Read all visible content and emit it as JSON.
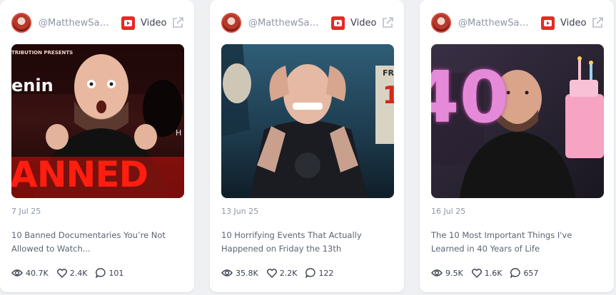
{
  "cards": [
    {
      "handle": "@MatthewSant...",
      "platform_label": "Video",
      "date": "7 Jul 25",
      "title": "10 Banned Documentaries You’re Not Allowed to Watch...",
      "views": "40.7K",
      "likes": "2.4K",
      "comments": "101",
      "thumb_text_1": "enin",
      "thumb_text_2": "ANNED",
      "thumb_text_3": "TRIBUTION PRESENTS",
      "thumb_text_4": "H"
    },
    {
      "handle": "@MatthewSant...",
      "platform_label": "Video",
      "date": "13 Jun 25",
      "title": "10 Horrifying Events That Actually Happened on Friday the 13th",
      "views": "35.8K",
      "likes": "2.2K",
      "comments": "122",
      "thumb_text_1": "FR",
      "thumb_text_2": "1"
    },
    {
      "handle": "@MatthewSant...",
      "platform_label": "Video",
      "date": "16 Jul 25",
      "title": "The 10 Most Important Things I've Learned in 40 Years of Life",
      "views": "9.5K",
      "likes": "1.6K",
      "comments": "657",
      "thumb_text_1": "40"
    }
  ],
  "colors": {
    "youtube_red": "#e22b24",
    "muted_text": "#8d96a5",
    "card_bg": "#ffffff",
    "page_bg": "#eef0f3"
  },
  "icons": [
    "youtube-icon",
    "external-link-icon",
    "eye-icon",
    "heart-icon",
    "comment-icon"
  ]
}
